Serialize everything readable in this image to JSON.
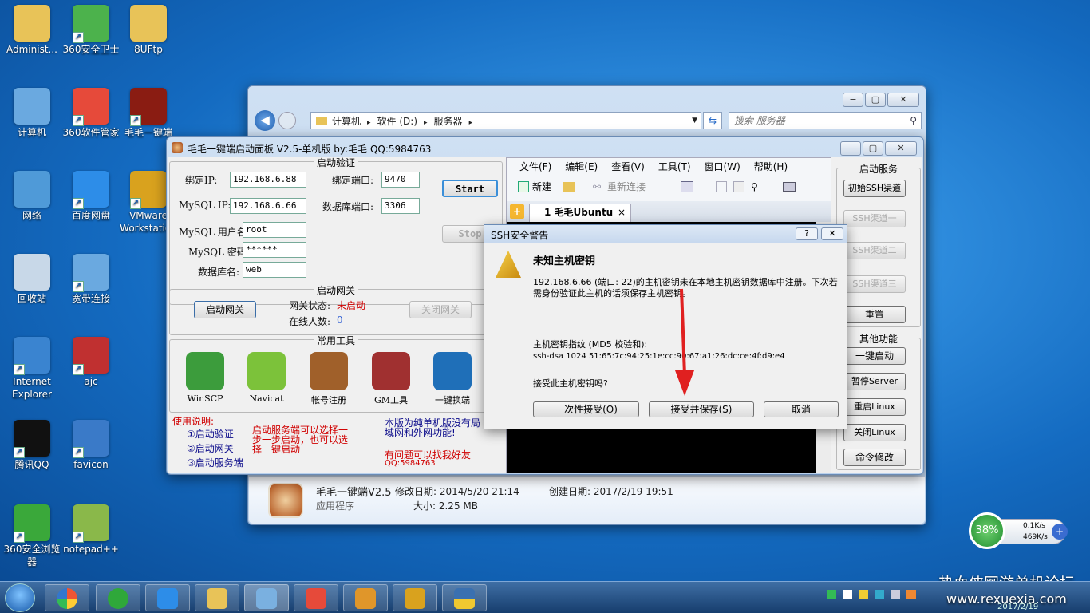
{
  "desktop_icons": [
    {
      "label": "Administ...",
      "icon": "user-folder-icon",
      "color": "#e8c358"
    },
    {
      "label": "360安全卫士",
      "icon": "360-safe-icon",
      "color": "#4cb24c"
    },
    {
      "label": "8UFtp",
      "icon": "folder-icon",
      "color": "#e8c358"
    },
    {
      "label": "计算机",
      "icon": "computer-icon",
      "color": "#6aa9e0"
    },
    {
      "label": "360软件管家",
      "icon": "360-software-icon",
      "color": "#e64a3a"
    },
    {
      "label": "毛毛一键端",
      "icon": "game-icon",
      "color": "#8a1c12"
    },
    {
      "label": "网络",
      "icon": "network-icon",
      "color": "#4f9ad8"
    },
    {
      "label": "百度网盘",
      "icon": "baidu-cloud-icon",
      "color": "#2d8de8"
    },
    {
      "label": "VMware Workstation",
      "icon": "vmware-icon",
      "color": "#d9a21e"
    },
    {
      "label": "回收站",
      "icon": "recycle-bin-icon",
      "color": "#c8d8e8"
    },
    {
      "label": "宽带连接",
      "icon": "broadband-icon",
      "color": "#6aa9e0"
    },
    {
      "label": "Internet Explorer",
      "icon": "ie-icon",
      "color": "#3a84d0"
    },
    {
      "label": "ajc",
      "icon": "archive-icon",
      "color": "#c03030"
    },
    {
      "label": "腾讯QQ",
      "icon": "qq-icon",
      "color": "#111111"
    },
    {
      "label": "favicon",
      "icon": "favicon-icon",
      "color": "#3a7ac8"
    },
    {
      "label": "360安全浏览器",
      "icon": "360-browser-icon",
      "color": "#3aa83a"
    },
    {
      "label": "notepad++",
      "icon": "notepad-icon",
      "color": "#8ab84a"
    }
  ],
  "explorer": {
    "breadcrumb": [
      "计算机",
      "软件 (D:)",
      "服务器"
    ],
    "search_placeholder": "搜索 服务器",
    "file_name": "毛毛一键端V2.5",
    "modified": "修改日期: 2014/5/20 21:14",
    "created": "创建日期: 2017/2/19 19:51",
    "type": "应用程序",
    "size": "大小: 2.25 MB"
  },
  "panel": {
    "title": "毛毛一键端启动面板 V2.5-单机版 by:毛毛  QQ:5984763",
    "auth_group": "启动验证",
    "bind_ip_label": "绑定IP:",
    "bind_ip": "192.168.6.88",
    "bind_port_label": "绑定端口:",
    "bind_port": "9470",
    "mysql_ip_label": "MySQL IP:",
    "mysql_ip": "192.168.6.66",
    "db_port_label": "数据库端口:",
    "db_port": "3306",
    "mysql_user_label": "MySQL 用户名:",
    "mysql_user": "root",
    "mysql_pwd_label": "MySQL 密码:",
    "mysql_pwd": "******",
    "db_name_label": "数据库名:",
    "db_name": "web",
    "start": "Start",
    "stop": "Stop",
    "gateway_group": "启动网关",
    "start_gateway": "启动网关",
    "gateway_status_label": "网关状态:",
    "gateway_status": "未启动",
    "online_label": "在线人数:",
    "online": "0",
    "close_gateway": "关闭网关",
    "tools_group": "常用工具",
    "tools": [
      {
        "label": "WinSCP",
        "icon": "winscp-icon",
        "color": "#3c9c3c"
      },
      {
        "label": "Navicat",
        "icon": "navicat-icon",
        "color": "#7cc23a"
      },
      {
        "label": "帐号注册",
        "icon": "account-register-icon",
        "color": "#a0602a"
      },
      {
        "label": "GM工具",
        "icon": "gm-tool-icon",
        "color": "#a03030"
      },
      {
        "label": "一键换端",
        "icon": "switch-icon",
        "color": "#1f6fb8"
      }
    ],
    "usage_title": "使用说明:",
    "usage_steps": [
      "①启动验证",
      "②启动网关",
      "③启动服务端"
    ],
    "usage_note": "启动服务端可以选择一步一步启动，也可以选择一键启动",
    "info_note": "本版为纯单机版没有局域网和外网功能!",
    "contact": "有问题可以找我好友",
    "contact_qq": "QQ:5984763",
    "service_group": "启动服务",
    "init_ssh": "初始SSH渠道",
    "ssh1": "SSH渠道一",
    "ssh2": "SSH渠道二",
    "ssh3": "SSH渠道三",
    "reset": "重置",
    "other_group": "其他功能",
    "one_click": "一键启动",
    "pause": "暂停Server",
    "restart": "重启Linux",
    "shutdown": "关闭Linux",
    "cmd": "命令修改"
  },
  "terminal": {
    "menus": [
      "文件(F)",
      "编辑(E)",
      "查看(V)",
      "工具(T)",
      "窗口(W)",
      "帮助(H)"
    ],
    "new_btn": "新建",
    "reconnect_btn": "重新连接",
    "tab": "1 毛毛Ubuntu"
  },
  "ssh_dialog": {
    "title": "SSH安全警告",
    "heading": "未知主机密钥",
    "message": "192.168.6.66 (端口: 22)的主机密钥未在本地主机密钥数据库中注册。下次若需身份验证此主机的话须保存主机密钥。",
    "fp_label": "主机密钥指纹 (MD5 校验和):",
    "fingerprint": "ssh-dsa 1024 51:65:7c:94:25:1e:cc:90:67:a1:26:dc:ce:4f:d9:e4",
    "question": "接受此主机密钥吗?",
    "accept_once": "一次性接受(O)",
    "accept_save": "接受并保存(S)",
    "cancel": "取消"
  },
  "net_widget": {
    "percent": "38%",
    "up": "0.1K/s",
    "down": "469K/s"
  },
  "watermark": {
    "line1": "热血侠网游单机论坛",
    "line2": "www.rexuexia.com"
  },
  "taskbar": {
    "clock_date": "2017/2/19"
  }
}
